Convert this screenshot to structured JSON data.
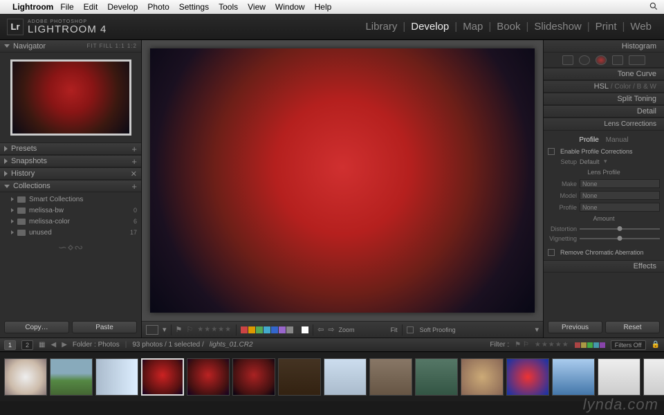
{
  "menubar": {
    "app": "Lightroom",
    "items": [
      "File",
      "Edit",
      "Develop",
      "Photo",
      "Settings",
      "Tools",
      "View",
      "Window",
      "Help"
    ]
  },
  "app": {
    "brand_small": "ADOBE PHOTOSHOP",
    "brand_big": "LIGHTROOM 4",
    "logo": "Lr"
  },
  "modules": {
    "items": [
      "Library",
      "Develop",
      "Map",
      "Book",
      "Slideshow",
      "Print",
      "Web"
    ],
    "active": "Develop"
  },
  "left": {
    "navigator": {
      "title": "Navigator",
      "opts": "FIT  FILL  1:1  1:2"
    },
    "presets": {
      "title": "Presets"
    },
    "snapshots": {
      "title": "Snapshots"
    },
    "history": {
      "title": "History"
    },
    "collections": {
      "title": "Collections",
      "items": [
        {
          "label": "Smart Collections",
          "count": ""
        },
        {
          "label": "melissa-bw",
          "count": "0"
        },
        {
          "label": "melissa-color",
          "count": "6"
        },
        {
          "label": "unused",
          "count": "17"
        }
      ]
    },
    "copy_btn": "Copy…",
    "paste_btn": "Paste"
  },
  "center": {
    "zoom_label": "Zoom",
    "fit_label": "Fit",
    "soft_proof": "Soft Proofing",
    "swatches": [
      "#c44",
      "#d90",
      "#5a5",
      "#4ac",
      "#36c",
      "#96c",
      "#888",
      "#333",
      "#fff"
    ]
  },
  "right": {
    "histogram": "Histogram",
    "tone_curve": "Tone Curve",
    "hsl": "HSL",
    "color": "Color",
    "bw": "B & W",
    "split": "Split Toning",
    "detail": "Detail",
    "lens": {
      "title": "Lens Corrections",
      "tab_profile": "Profile",
      "tab_manual": "Manual",
      "enable": "Enable Profile Corrections",
      "setup_lbl": "Setup",
      "setup_val": "Default",
      "profile_hdr": "Lens Profile",
      "make_lbl": "Make",
      "make_val": "None",
      "model_lbl": "Model",
      "model_val": "None",
      "profile_lbl": "Profile",
      "profile_val": "None",
      "amount_hdr": "Amount",
      "distortion": "Distortion",
      "vignetting": "Vignetting",
      "chromatic": "Remove Chromatic Aberration"
    },
    "effects": "Effects",
    "previous_btn": "Previous",
    "reset_btn": "Reset"
  },
  "status": {
    "badges": [
      "1",
      "2"
    ],
    "folder": "Folder : Photos",
    "count": "93 photos / 1 selected /",
    "file": "lights_01.CR2",
    "filter_lbl": "Filter :",
    "filters_off": "Filters Off"
  },
  "filmstrip": {
    "thumbs": [
      "radial-gradient(circle,#eee,#cba 60%,#877)",
      "linear-gradient(#8ab 40%,#584 60%,#463)",
      "linear-gradient(90deg,#abc,#def)",
      "radial-gradient(circle at 50% 45%,#c22,#511 70%,#102)",
      "radial-gradient(circle at 50% 45%,#b22,#411 70%,#102)",
      "radial-gradient(circle at 50% 45%,#a22,#411 70%,#001)",
      "linear-gradient(#432,#321)",
      "linear-gradient(#cde,#abc)",
      "linear-gradient(#876,#654)",
      "linear-gradient(#576,#354)",
      "radial-gradient(circle,#ca7,#865)",
      "radial-gradient(circle,#e33,#13a)",
      "linear-gradient(#ace,#47a)",
      "linear-gradient(#eee,#ccc)",
      "linear-gradient(#eee,#ccc)",
      "linear-gradient(#ddd,#bbb)"
    ],
    "selected": 3
  },
  "watermark": "lynda.com"
}
